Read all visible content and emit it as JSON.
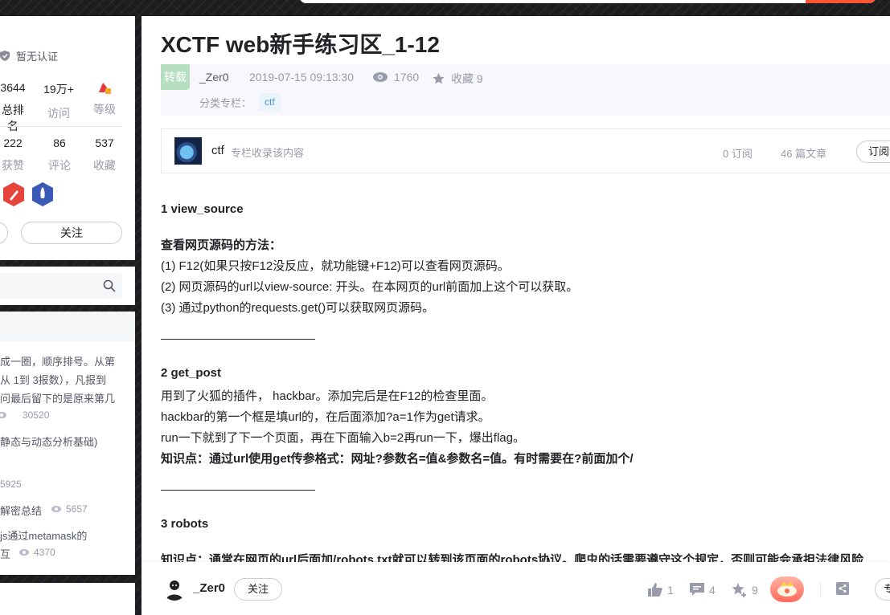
{
  "sidebar": {
    "certification": "暂无认证",
    "stats_top": [
      {
        "num": "3644",
        "label": "总排名"
      },
      {
        "num": "19万+",
        "label": "访问"
      },
      {
        "num": "",
        "label": "等级"
      }
    ],
    "stats_bottom": [
      {
        "num": "222",
        "label": "获赞"
      },
      {
        "num": "86",
        "label": "评论"
      },
      {
        "num": "537",
        "label": "收藏"
      }
    ],
    "follow_label": "关注",
    "hot_articles": [
      {
        "lines": [
          "成一圈，顺序排号。从第",
          "从 1到 3报数），凡报到",
          "问最后留下的是原来第几"
        ],
        "views": "30520"
      },
      {
        "lines": [
          "静态与动态分析基础)"
        ],
        "views": "5925"
      },
      {
        "lines": [
          "解密总结"
        ],
        "views": "5657"
      },
      {
        "lines": [
          "js通过metamask的",
          "互"
        ],
        "views": "4370"
      }
    ]
  },
  "article": {
    "title": "XCTF web新手练习区_1-12",
    "repost_tag": "转载",
    "author": "_Zer0",
    "date": "2019-07-15 09:13:30",
    "views": "1760",
    "favorites": "收藏 9",
    "category_label": "分类专栏：",
    "category_tag": "ctf",
    "column": {
      "name": "ctf",
      "desc": "专栏收录该内容",
      "subscribers": "0 订阅",
      "articles": "46 篇文章",
      "subscribe_btn": "订阅专栏"
    },
    "sections": {
      "s1_title": "1 view_source",
      "s1_sub": "查看网页源码的方法：",
      "s1_l1": "(1) F12(如果只按F12没反应，就功能键+F12)可以查看网页源码。",
      "s1_l2": "(2) 网页源码的url以view-source: 开头。在本网页的url前面加上这个可以获取。",
      "s1_l3": "(3) 通过python的requests.get()可以获取网页源码。",
      "s2_title": "2 get_post",
      "s2_l1": "用到了火狐的插件， hackbar。添加完后是在F12的检查里面。",
      "s2_l2": "hackbar的第一个框是填url的，在后面添加?a=1作为get请求。",
      "s2_l3": "run一下就到了下一个页面，再在下面输入b=2再run一下，爆出flag。",
      "s2_kp": "知识点：通过url使用get传参格式：网址?参数名=值&参数名=值。有时需要在?前面加个/",
      "s3_title": "3 robots",
      "s3_kp": "知识点：通常在网页的url后面加/robots.txt就可以转到该页面的robots协议。爬虫的话需要遵守这个规定，否则可能会承担法律风险"
    }
  },
  "toolbar": {
    "author": "_Zer0",
    "follow": "关注",
    "likes": "1",
    "comments": "4",
    "stars": "9",
    "special": "专栏"
  }
}
